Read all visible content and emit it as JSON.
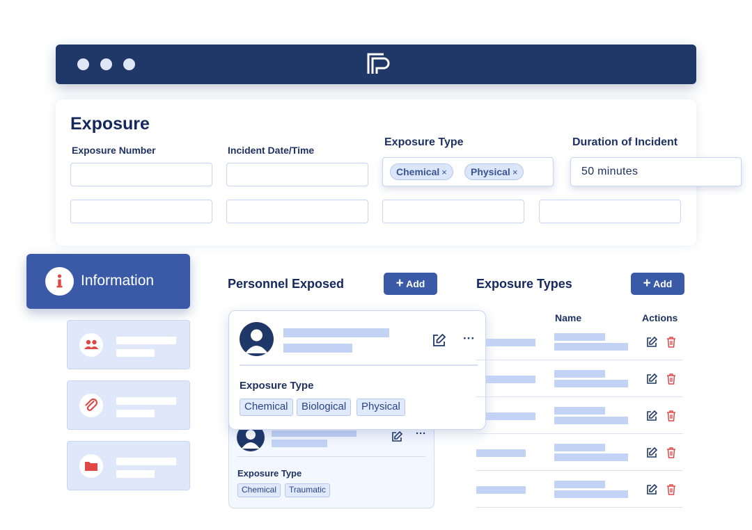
{
  "form": {
    "title": "Exposure",
    "fields": {
      "exposure_number_label": "Exposure Number",
      "incident_datetime_label": "Incident Date/Time",
      "exposure_type_label": "Exposure Type",
      "duration_label": "Duration of Incident",
      "duration_value": "50 minutes"
    },
    "exposure_type_chips": [
      "Chemical",
      "Physical"
    ],
    "chip_remove_glyph": "×"
  },
  "sidebar": {
    "active_item": {
      "label": "Information",
      "icon": "info-icon"
    },
    "items": [
      {
        "icon": "people-icon"
      },
      {
        "icon": "paperclip-icon"
      },
      {
        "icon": "folder-icon"
      }
    ]
  },
  "personnel": {
    "title": "Personnel Exposed",
    "add_label": "Add",
    "cards": [
      {
        "exposure_type_label": "Exposure Type",
        "tags": [
          "Chemical",
          "Biological",
          "Physical"
        ]
      },
      {
        "exposure_type_label": "Exposure Type",
        "tags": [
          "Chemical",
          "Traumatic"
        ]
      }
    ],
    "more_glyph": "···"
  },
  "exposure_types": {
    "title": "Exposure Types",
    "add_label": "Add",
    "columns": {
      "name": "Name",
      "actions": "Actions"
    },
    "row_count": 5
  },
  "colors": {
    "brand_navy": "#1f3868",
    "accent_blue": "#3a5aa8",
    "placeholder": "#c3d3f5",
    "danger_red": "#e04848"
  }
}
